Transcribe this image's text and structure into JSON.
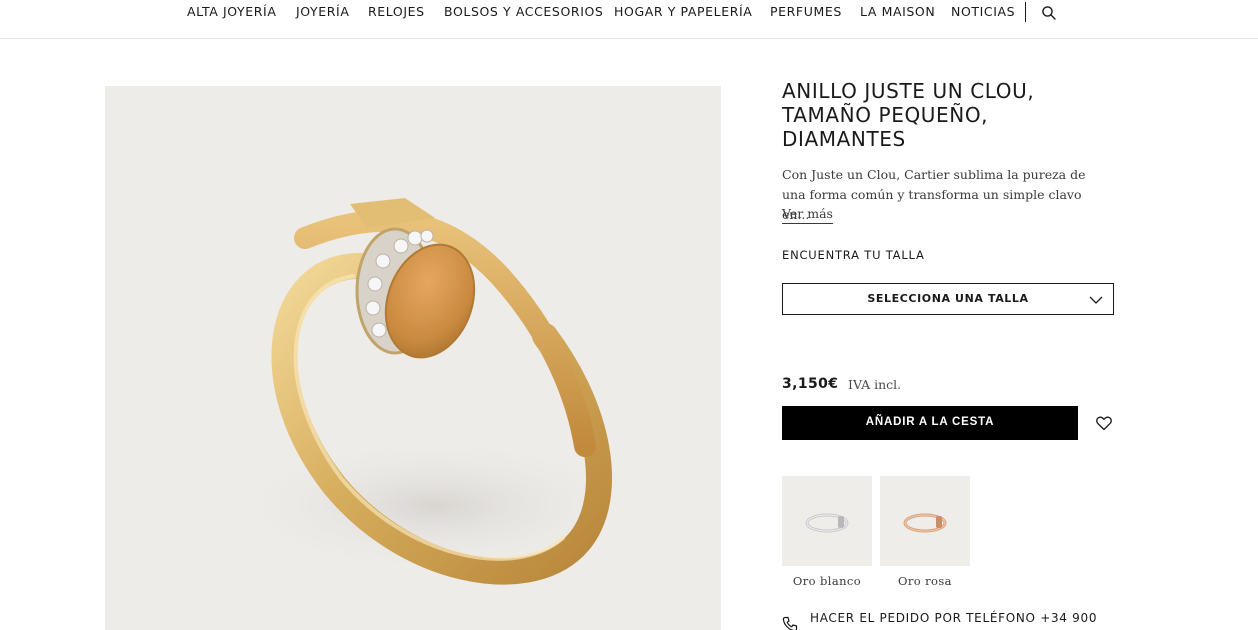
{
  "nav": {
    "items": [
      "ALTA JOYERÍA",
      "JOYERÍA",
      "RELOJES",
      "BOLSOS Y ACCESORIOS",
      "HOGAR Y PAPELERÍA",
      "PERFUMES",
      "LA MAISON",
      "NOTICIAS"
    ],
    "search_icon": "search-icon"
  },
  "product": {
    "title": "ANILLO JUSTE UN CLOU, TAMAÑO PEQUEÑO, DIAMANTES",
    "description": "Con Juste un Clou, Cartier sublima la pureza de una forma común y transforma un simple clavo en...",
    "more_link": "Ver más",
    "size_label": "ENCUENTRA TU TALLA",
    "size_select": "SELECCIONA UNA TALLA",
    "price": "3,150€",
    "tax_note": "IVA incl.",
    "add_to_cart": "AÑADIR A LA CESTA",
    "wishlist_icon": "heart-icon",
    "variants": [
      {
        "label": "Oro blanco",
        "color": "#c9c9cc"
      },
      {
        "label": "Oro rosa",
        "color": "#d9a07c"
      }
    ],
    "phone_order": "HACER EL PEDIDO POR TELÉFONO +34 900",
    "image_alt_colors": {
      "background": "#eeece9",
      "gold": "#d9b36a"
    }
  }
}
